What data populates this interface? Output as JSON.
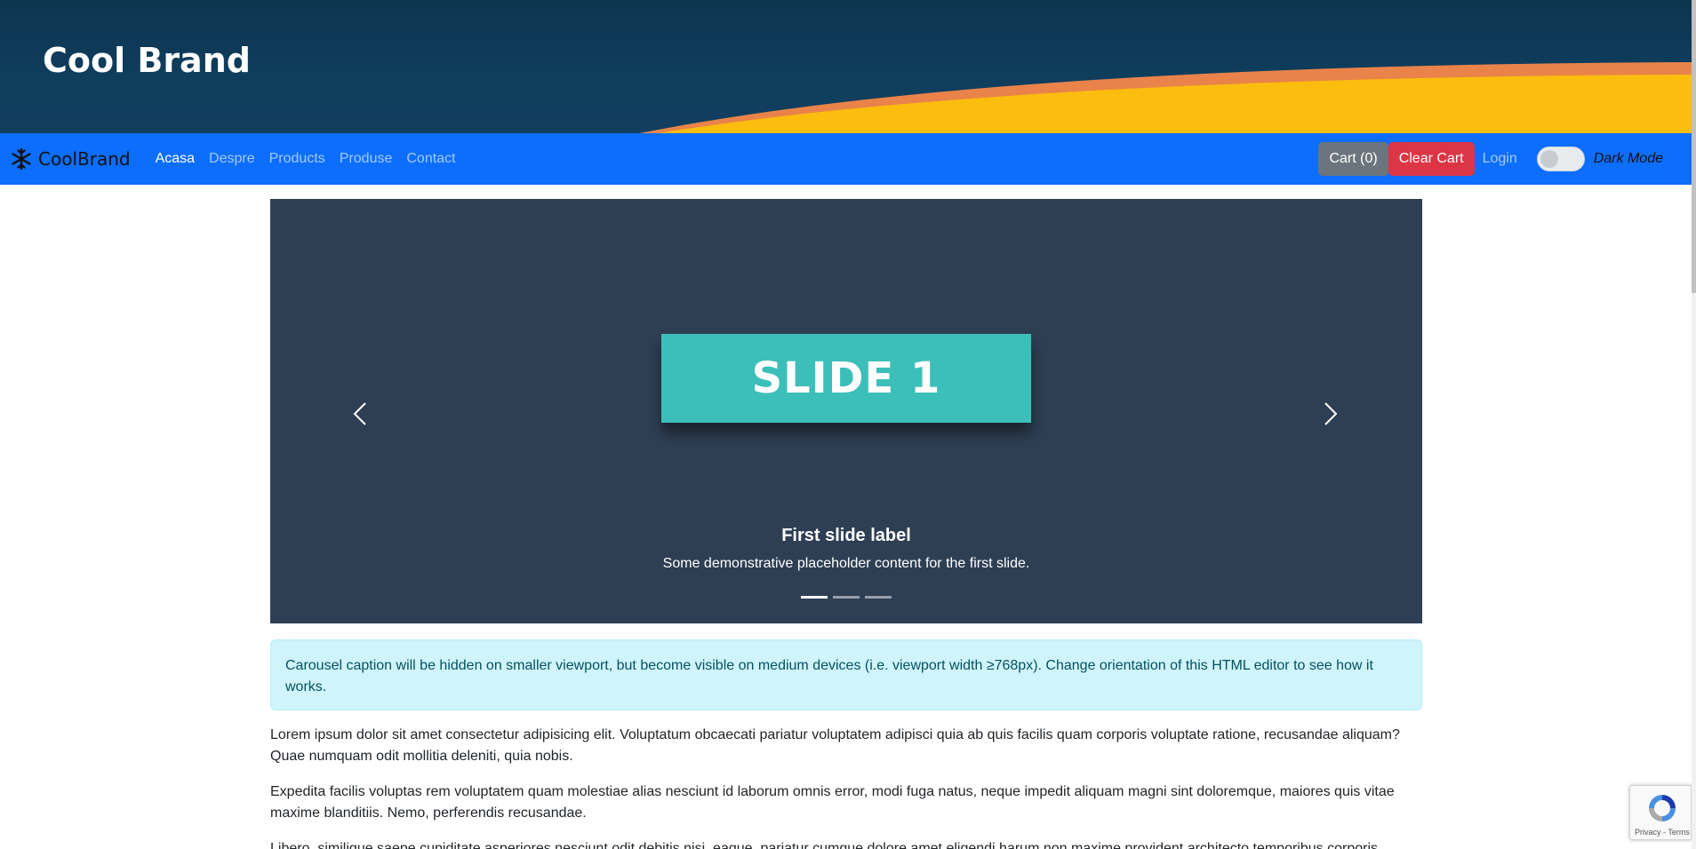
{
  "header": {
    "title": "Cool Brand"
  },
  "navbar": {
    "brand": "CoolBrand",
    "links": [
      {
        "label": "Acasa",
        "active": true
      },
      {
        "label": "Despre",
        "active": false
      },
      {
        "label": "Products",
        "active": false
      },
      {
        "label": "Produse",
        "active": false
      },
      {
        "label": "Contact",
        "active": false
      }
    ],
    "cart_label": "Cart (0)",
    "clear_cart_label": "Clear Cart",
    "login_label": "Login",
    "dark_mode_label": "Dark Mode"
  },
  "carousel": {
    "slide_text": "SLIDE 1",
    "caption_title": "First slide label",
    "caption_text": "Some demonstrative placeholder content for the first slide.",
    "indicator_count": 3,
    "active_index": 0
  },
  "alert": {
    "text": "Carousel caption will be hidden on smaller viewport, but become visible on medium devices (i.e. viewport width ≥768px). Change orientation of this HTML editor to see how it works."
  },
  "content": {
    "paragraphs": [
      "Lorem ipsum dolor sit amet consectetur adipisicing elit. Voluptatum obcaecati pariatur voluptatem adipisci quia ab quis facilis quam corporis voluptate ratione, recusandae aliquam? Quae numquam odit mollitia deleniti, quia nobis.",
      "Expedita facilis voluptas rem voluptatem quam molestiae alias nesciunt id laborum omnis error, modi fuga natus, neque impedit aliquam magni sint doloremque, maiores quis vitae maxime blanditiis. Nemo, perferendis recusandae.",
      "Libero, similique saepe cupiditate asperiores nesciunt odit debitis nisi, eaque, pariatur cumque dolore amet eligendi harum non maxime provident architecto temporibus corporis."
    ]
  },
  "recaptcha": {
    "footer": "Privacy - Terms"
  },
  "colors": {
    "navbar": "#0d6efd",
    "banner": "#0f3d5c",
    "wave_orange": "#e9834a",
    "wave_yellow": "#fbbd0e",
    "carousel_bg": "#2e3f54",
    "slide_teal": "#3dbfb9",
    "cart_button": "#6c757d",
    "clear_button": "#dc3545",
    "alert_bg": "#cff4fc"
  },
  "icons": {
    "brand": "snowflake-icon",
    "prev": "chevron-left-icon",
    "next": "chevron-right-icon",
    "recaptcha": "recaptcha-logo-icon"
  }
}
